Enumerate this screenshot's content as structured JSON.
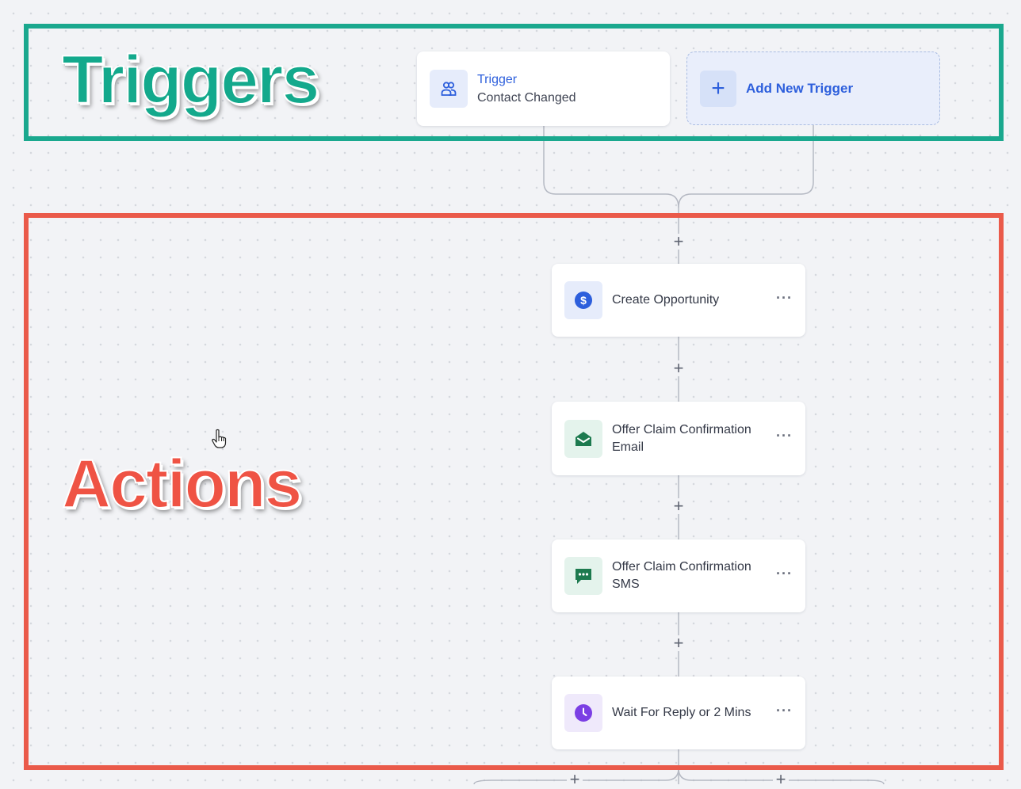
{
  "labels": {
    "triggers": "Triggers",
    "actions": "Actions"
  },
  "trigger_card": {
    "title": "Trigger",
    "subtitle": "Contact Changed",
    "icon": "users-icon"
  },
  "add_trigger": {
    "label": "Add New Trigger",
    "icon": "plus-icon"
  },
  "actions": [
    {
      "label": "Create Opportunity",
      "icon": "dollar-circle-icon"
    },
    {
      "label": "Offer Claim Confirmation Email",
      "icon": "email-open-icon"
    },
    {
      "label": "Offer Claim Confirmation SMS",
      "icon": "chat-bubble-icon"
    },
    {
      "label": "Wait For Reply or 2 Mins",
      "icon": "clock-icon"
    }
  ],
  "menu_glyph": "···",
  "plus_glyph": "+",
  "colors": {
    "triggers_accent": "#1aa88e",
    "actions_accent": "#ea5a4a",
    "brand_blue": "#2d5fdc",
    "email_green": "#1d7a4f",
    "wait_purple": "#7b3fe4"
  }
}
